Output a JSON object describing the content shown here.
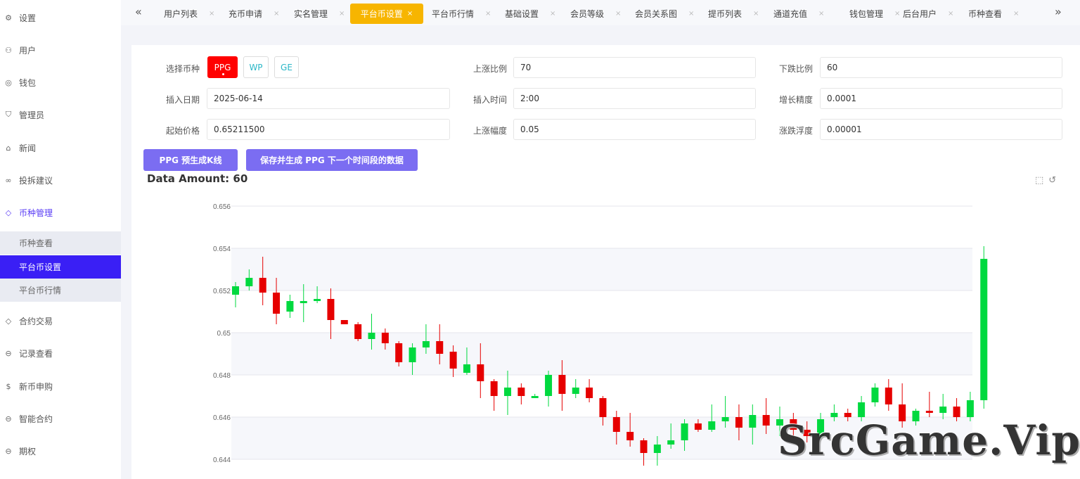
{
  "sidebar": {
    "items": [
      {
        "label": "设置",
        "icon": "gear-icon"
      },
      {
        "label": "用户",
        "icon": "user-icon"
      },
      {
        "label": "钱包",
        "icon": "wallet-icon"
      },
      {
        "label": "管理员",
        "icon": "shield-icon"
      },
      {
        "label": "新闻",
        "icon": "tag-icon"
      },
      {
        "label": "投拆建议",
        "icon": "link-icon"
      },
      {
        "label": "币种管理",
        "icon": "diamond-icon"
      },
      {
        "label": "合约交易",
        "icon": "diamond-icon"
      },
      {
        "label": "记录查看",
        "icon": "circle-arrow-icon"
      },
      {
        "label": "新币申购",
        "icon": "dollar-icon"
      },
      {
        "label": "智能合约",
        "icon": "circle-arrow-icon"
      },
      {
        "label": "期权",
        "icon": "circle-arrow-icon"
      }
    ],
    "subitems": [
      "币种查看",
      "平台币设置",
      "平台币行情"
    ]
  },
  "tabs": [
    "用户列表",
    "充币申请",
    "实名管理",
    "平台币设置",
    "平台币行情",
    "基础设置",
    "会员等级",
    "会员关系图",
    "提币列表",
    "通道充值",
    "钱包管理",
    "后台用户",
    "币种查看"
  ],
  "icons": {
    "prev": "double-chevron-left-icon",
    "next": "double-chevron-right-icon",
    "close": "close-icon"
  },
  "form": {
    "coin_label": "选择币种",
    "coins": [
      "PPG",
      "WP",
      "GE"
    ],
    "selected_coin": "PPG",
    "rise_ratio_label": "上涨比例",
    "rise_ratio": "70",
    "fall_ratio_label": "下跌比例",
    "fall_ratio": "60",
    "insert_date_label": "插入日期",
    "insert_date": "2025-06-14",
    "insert_time_label": "插入时间",
    "insert_time": "2:00",
    "growth_precision_label": "增长精度",
    "growth_precision": "0.0001",
    "start_price_label": "起始价格",
    "start_price": "0.65211500",
    "rise_range_label": "上涨幅度",
    "rise_range": "0.05",
    "fluctuation_label": "涨跌浮度",
    "fluctuation": "0.00001"
  },
  "buttons": {
    "pregenerate": "PPG 预生成K线",
    "save_generate": "保存并生成 PPG 下一个时间段的数据"
  },
  "data_amount": "Data Amount: 60",
  "watermark": "SrcGame.Vip",
  "colors": {
    "up": "#00d93f",
    "down": "#e60000",
    "active_tab": "#f7b500",
    "active_menu": "#3a1ff5",
    "button": "#7b6df2"
  },
  "chart_data": {
    "type": "candlestick",
    "ylim": [
      0.6435,
      0.6565
    ],
    "y_ticks": [
      "0.644",
      "0.646",
      "0.648",
      "0.65",
      "0.652",
      "0.654",
      "0.656"
    ],
    "grid": true,
    "candles": [
      {
        "o": 0.6518,
        "c": 0.6522,
        "h": 0.6524,
        "l": 0.6512
      },
      {
        "o": 0.6522,
        "c": 0.6526,
        "h": 0.653,
        "l": 0.652
      },
      {
        "o": 0.6526,
        "c": 0.6519,
        "h": 0.6536,
        "l": 0.6513
      },
      {
        "o": 0.6519,
        "c": 0.6509,
        "h": 0.6526,
        "l": 0.6504
      },
      {
        "o": 0.651,
        "c": 0.6515,
        "h": 0.6518,
        "l": 0.6507
      },
      {
        "o": 0.6514,
        "c": 0.6515,
        "h": 0.6523,
        "l": 0.6505
      },
      {
        "o": 0.6515,
        "c": 0.6516,
        "h": 0.6522,
        "l": 0.6514
      },
      {
        "o": 0.6516,
        "c": 0.6506,
        "h": 0.6521,
        "l": 0.6497
      },
      {
        "o": 0.6506,
        "c": 0.6504,
        "h": 0.6506,
        "l": 0.6504
      },
      {
        "o": 0.6504,
        "c": 0.6497,
        "h": 0.6505,
        "l": 0.6496
      },
      {
        "o": 0.6497,
        "c": 0.65,
        "h": 0.6509,
        "l": 0.6492
      },
      {
        "o": 0.65,
        "c": 0.6495,
        "h": 0.6502,
        "l": 0.6492
      },
      {
        "o": 0.6495,
        "c": 0.6486,
        "h": 0.6496,
        "l": 0.6484
      },
      {
        "o": 0.6486,
        "c": 0.6493,
        "h": 0.6495,
        "l": 0.648
      },
      {
        "o": 0.6493,
        "c": 0.6496,
        "h": 0.6504,
        "l": 0.649
      },
      {
        "o": 0.6496,
        "c": 0.649,
        "h": 0.6504,
        "l": 0.6485
      },
      {
        "o": 0.6491,
        "c": 0.6483,
        "h": 0.6494,
        "l": 0.6479
      },
      {
        "o": 0.6481,
        "c": 0.6485,
        "h": 0.6493,
        "l": 0.648
      },
      {
        "o": 0.6485,
        "c": 0.6477,
        "h": 0.6495,
        "l": 0.6469
      },
      {
        "o": 0.6477,
        "c": 0.647,
        "h": 0.6478,
        "l": 0.6463
      },
      {
        "o": 0.647,
        "c": 0.6474,
        "h": 0.6482,
        "l": 0.6461
      },
      {
        "o": 0.6474,
        "c": 0.647,
        "h": 0.6476,
        "l": 0.6466
      },
      {
        "o": 0.6469,
        "c": 0.647,
        "h": 0.6471,
        "l": 0.6469
      },
      {
        "o": 0.647,
        "c": 0.648,
        "h": 0.6482,
        "l": 0.6465
      },
      {
        "o": 0.648,
        "c": 0.6471,
        "h": 0.6487,
        "l": 0.6463
      },
      {
        "o": 0.6471,
        "c": 0.6474,
        "h": 0.6478,
        "l": 0.6469
      },
      {
        "o": 0.6474,
        "c": 0.6469,
        "h": 0.6478,
        "l": 0.6467
      },
      {
        "o": 0.6469,
        "c": 0.646,
        "h": 0.647,
        "l": 0.6456
      },
      {
        "o": 0.646,
        "c": 0.6453,
        "h": 0.6463,
        "l": 0.6447
      },
      {
        "o": 0.6453,
        "c": 0.6449,
        "h": 0.6462,
        "l": 0.6446
      },
      {
        "o": 0.6449,
        "c": 0.6443,
        "h": 0.645,
        "l": 0.6437
      },
      {
        "o": 0.6443,
        "c": 0.6447,
        "h": 0.6451,
        "l": 0.6437
      },
      {
        "o": 0.6447,
        "c": 0.6449,
        "h": 0.6457,
        "l": 0.6445
      },
      {
        "o": 0.6449,
        "c": 0.6457,
        "h": 0.6459,
        "l": 0.6444
      },
      {
        "o": 0.6457,
        "c": 0.6454,
        "h": 0.6459,
        "l": 0.6453
      },
      {
        "o": 0.6454,
        "c": 0.6458,
        "h": 0.6466,
        "l": 0.6453
      },
      {
        "o": 0.6458,
        "c": 0.646,
        "h": 0.647,
        "l": 0.6455
      },
      {
        "o": 0.646,
        "c": 0.6455,
        "h": 0.6466,
        "l": 0.6449
      },
      {
        "o": 0.6455,
        "c": 0.6461,
        "h": 0.6466,
        "l": 0.6447
      },
      {
        "o": 0.6461,
        "c": 0.6456,
        "h": 0.6469,
        "l": 0.6452
      },
      {
        "o": 0.6456,
        "c": 0.6459,
        "h": 0.6465,
        "l": 0.6451
      },
      {
        "o": 0.6459,
        "c": 0.6454,
        "h": 0.6462,
        "l": 0.645
      },
      {
        "o": 0.6454,
        "c": 0.6451,
        "h": 0.6458,
        "l": 0.6448
      },
      {
        "o": 0.6451,
        "c": 0.6459,
        "h": 0.6462,
        "l": 0.645
      },
      {
        "o": 0.646,
        "c": 0.6462,
        "h": 0.6466,
        "l": 0.6458
      },
      {
        "o": 0.6462,
        "c": 0.646,
        "h": 0.6464,
        "l": 0.6458
      },
      {
        "o": 0.646,
        "c": 0.6467,
        "h": 0.647,
        "l": 0.6458
      },
      {
        "o": 0.6467,
        "c": 0.6474,
        "h": 0.6476,
        "l": 0.6465
      },
      {
        "o": 0.6474,
        "c": 0.6466,
        "h": 0.6478,
        "l": 0.6463
      },
      {
        "o": 0.6466,
        "c": 0.6458,
        "h": 0.6476,
        "l": 0.6455
      },
      {
        "o": 0.6458,
        "c": 0.6463,
        "h": 0.6464,
        "l": 0.6456
      },
      {
        "o": 0.6463,
        "c": 0.6462,
        "h": 0.6472,
        "l": 0.646
      },
      {
        "o": 0.6462,
        "c": 0.6465,
        "h": 0.6471,
        "l": 0.6459
      },
      {
        "o": 0.6465,
        "c": 0.646,
        "h": 0.6469,
        "l": 0.6458
      },
      {
        "o": 0.646,
        "c": 0.6468,
        "h": 0.6472,
        "l": 0.6458
      },
      {
        "o": 0.6468,
        "c": 0.6535,
        "h": 0.6541,
        "l": 0.6464
      }
    ]
  }
}
